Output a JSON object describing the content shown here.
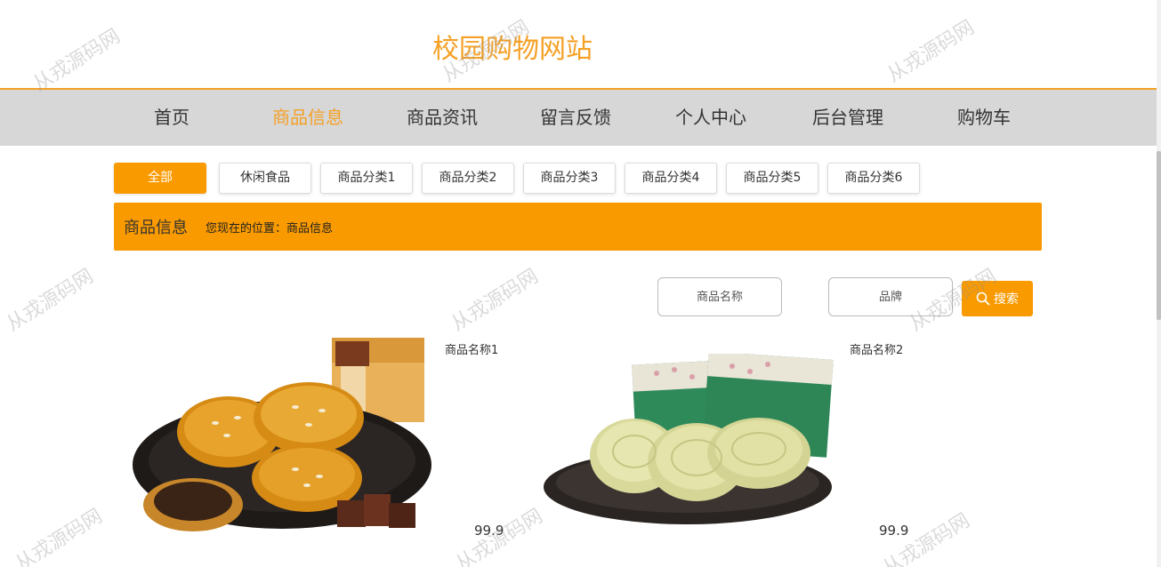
{
  "site": {
    "title": "校园购物网站"
  },
  "nav": {
    "items": [
      "首页",
      "商品信息",
      "商品资讯",
      "留言反馈",
      "个人中心",
      "后台管理",
      "购物车"
    ],
    "active_index": 1
  },
  "categories": {
    "items": [
      "全部",
      "休闲食品",
      "商品分类1",
      "商品分类2",
      "商品分类3",
      "商品分类4",
      "商品分类5",
      "商品分类6"
    ],
    "active_index": 0
  },
  "breadcrumb": {
    "title": "商品信息",
    "path": "您现在的位置：商品信息"
  },
  "search": {
    "name_placeholder": "商品名称",
    "brand_placeholder": "品牌",
    "button_label": "搜索"
  },
  "products": [
    {
      "name": "商品名称1",
      "price": "99.9",
      "image": "pastry-with-sesame-and-box"
    },
    {
      "name": "商品名称2",
      "price": "99.9",
      "image": "mung-bean-cake-with-green-packets"
    }
  ],
  "watermark": {
    "text": "从戎源码网"
  },
  "colors": {
    "accent": "#f99a00",
    "title": "#f5a025",
    "nav_bg": "#d7d7d7"
  }
}
